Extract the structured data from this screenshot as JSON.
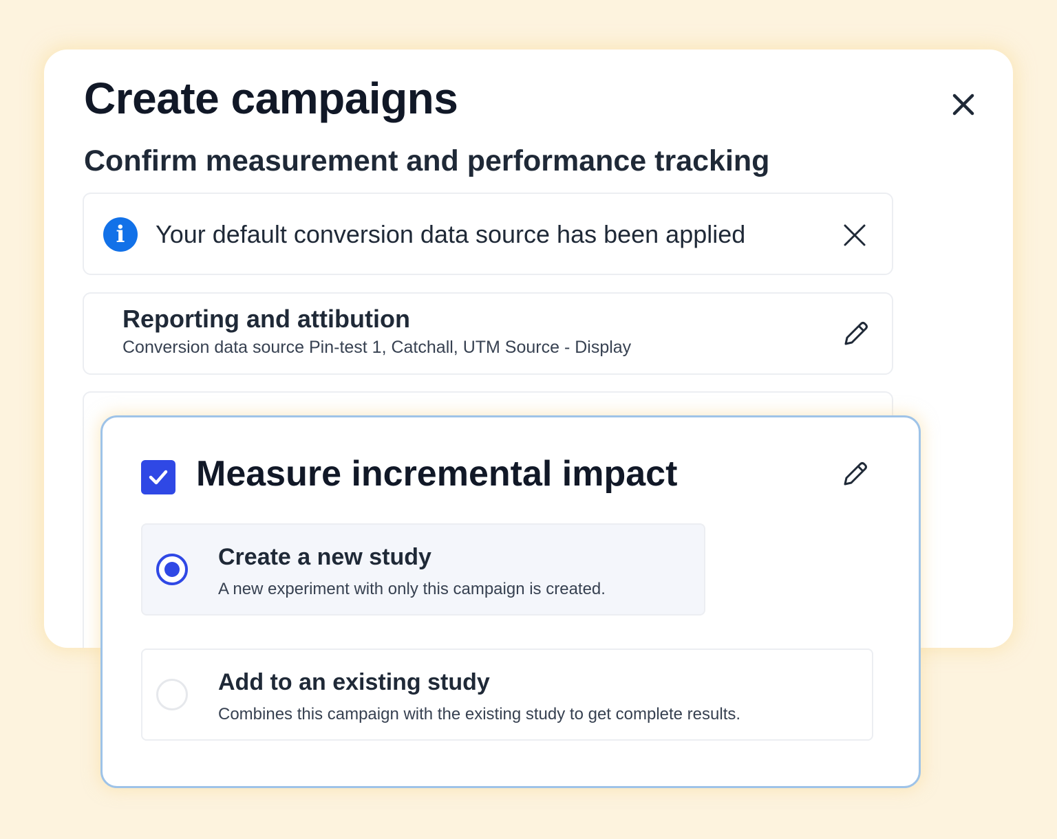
{
  "modal": {
    "title": "Create campaigns",
    "subtitle": "Confirm measurement and performance tracking",
    "close_icon": "close-icon"
  },
  "banner": {
    "icon": "info-icon",
    "icon_glyph": "i",
    "text": "Your default conversion data source has been applied",
    "dismiss_icon": "close-icon"
  },
  "reporting": {
    "title": "Reporting and attibution",
    "description": "Conversion data source Pin-test 1, Catchall, UTM Source - Display",
    "edit_icon": "pencil-icon"
  },
  "incremental": {
    "checked": true,
    "title": "Measure incremental impact",
    "edit_icon": "pencil-icon",
    "options": [
      {
        "title": "Create a new study",
        "description": "A new experiment with only this campaign is created.",
        "selected": true
      },
      {
        "title": "Add to an existing study",
        "description": "Combines this campaign with the existing study to get complete results.",
        "selected": false
      }
    ]
  },
  "colors": {
    "background": "#fdf3de",
    "accent": "#2f48e5",
    "info_blue": "#1271e8",
    "card_border_highlight": "#9ec3e8"
  }
}
